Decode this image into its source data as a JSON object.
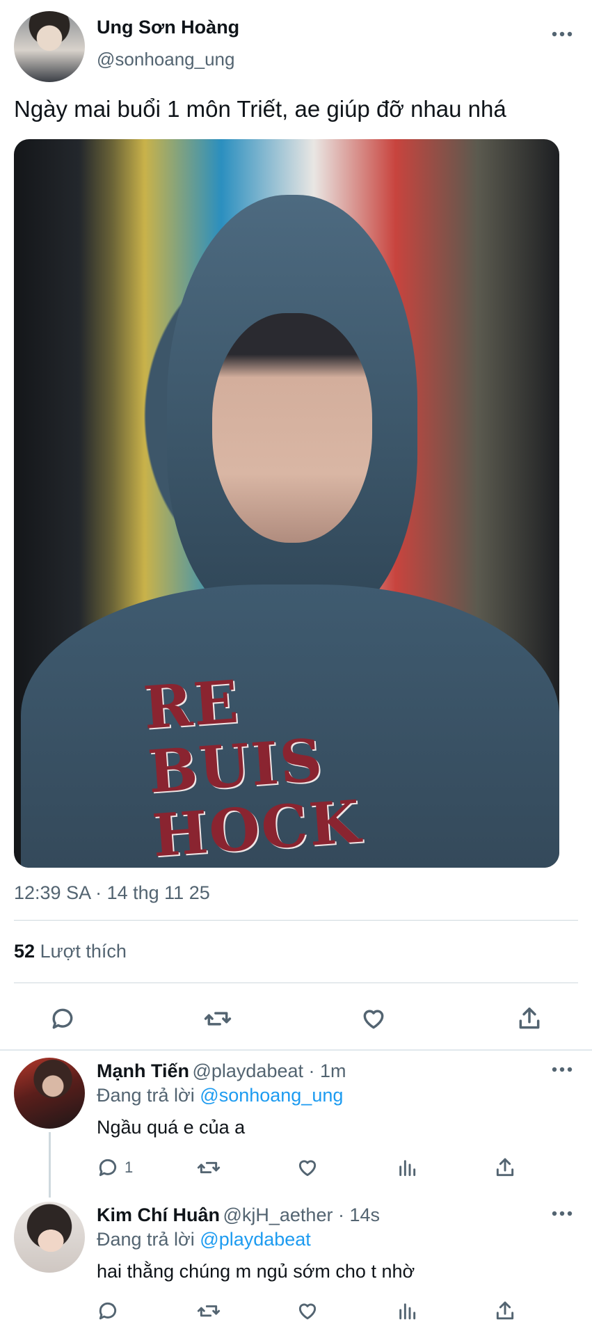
{
  "tweet": {
    "display_name": "Ung Sơn Hoàng",
    "handle": "@sonhoang_ung",
    "text": "Ngày mai buổi 1 môn Triết, ae giúp đỡ nhau nhá",
    "photo_print_line1": "RE BUIS",
    "photo_print_line2": "HOCK",
    "timestamp": "12:39 SA · 14 thg 11 25",
    "likes_count": "52",
    "likes_label": "Lượt thích",
    "actions": [
      "reply-icon",
      "retweet-icon",
      "like-icon",
      "share-icon"
    ]
  },
  "replies": [
    {
      "display_name": "Mạnh Tiến",
      "handle_time": "@playdabeat · 1m",
      "replying_prefix": "Đang trả lời",
      "replying_to": "@sonhoang_ung",
      "text": "Ngầu quá e của a",
      "reply_count": "1"
    },
    {
      "display_name": "Kim Chí Huân",
      "handle_time": "@kjH_aether · 14s",
      "replying_prefix": "Đang trả lời",
      "replying_to": "@playdabeat",
      "text": "hai thằng chúng m ngủ sớm cho t nhờ",
      "reply_count": ""
    }
  ],
  "colors": {
    "text": "#0f1419",
    "secondary": "#536471",
    "accent": "#1d9bf0",
    "divider": "#cfd9de"
  }
}
